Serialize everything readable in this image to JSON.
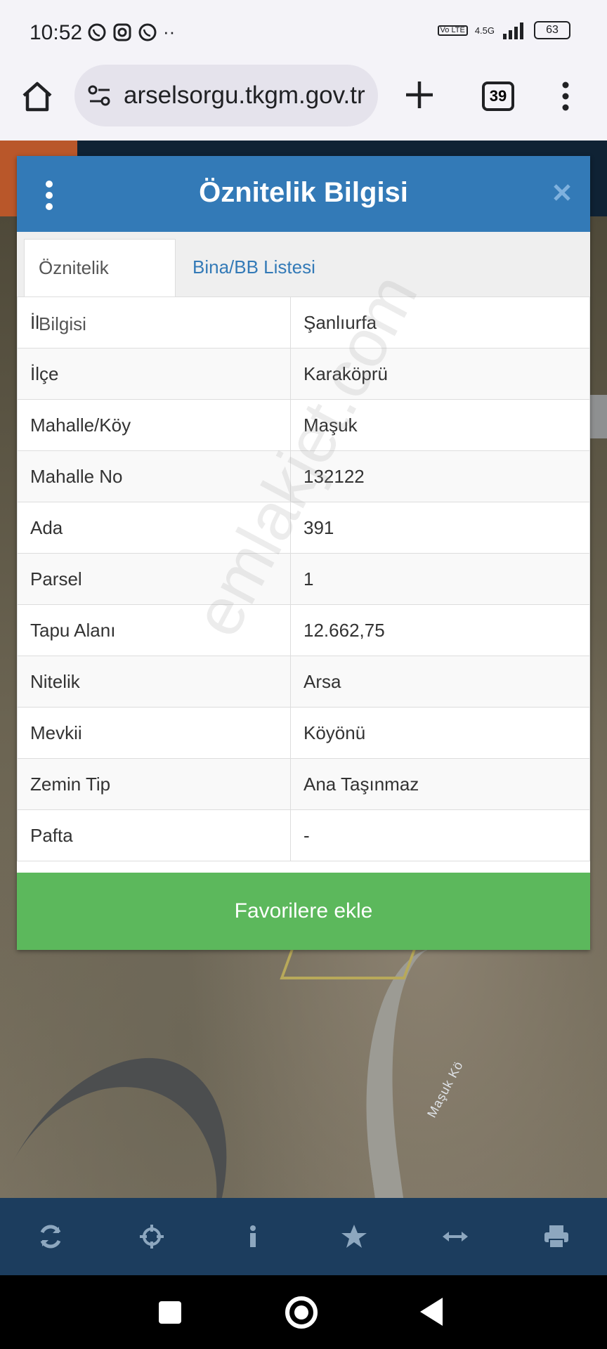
{
  "status_bar": {
    "time": "10:52",
    "network": "4.5G",
    "volte": "Vo LTE",
    "battery": "63"
  },
  "browser": {
    "url": "arselsorgu.tkgm.gov.tr",
    "tab_count": "39"
  },
  "map": {
    "road_label": "Maşuk Kö"
  },
  "modal": {
    "title": "Öznitelik Bilgisi",
    "tabs": [
      {
        "label": "Öznitelik Bilgisi",
        "active": true
      },
      {
        "label": "Bina/BB Listesi",
        "active": false
      }
    ],
    "rows": [
      {
        "key": "İl",
        "value": "Şanlıurfa"
      },
      {
        "key": "İlçe",
        "value": "Karaköprü"
      },
      {
        "key": "Mahalle/Köy",
        "value": "Maşuk"
      },
      {
        "key": "Mahalle No",
        "value": "132122"
      },
      {
        "key": "Ada",
        "value": "391"
      },
      {
        "key": "Parsel",
        "value": "1"
      },
      {
        "key": "Tapu Alanı",
        "value": "12.662,75"
      },
      {
        "key": "Nitelik",
        "value": "Arsa"
      },
      {
        "key": "Mevkii",
        "value": "Köyönü"
      },
      {
        "key": "Zemin Tip",
        "value": "Ana Taşınmaz"
      },
      {
        "key": "Pafta",
        "value": "-"
      }
    ],
    "favorite_button": "Favorilere ekle",
    "watermark": "emlakjet.com"
  },
  "toolbar": {
    "icons": [
      "refresh-icon",
      "crosshair-icon",
      "info-icon",
      "star-icon",
      "measure-icon",
      "print-icon"
    ]
  },
  "colors": {
    "header_blue": "#337ab7",
    "button_green": "#5cb85c",
    "toolbar_navy": "#1c3d5e"
  }
}
